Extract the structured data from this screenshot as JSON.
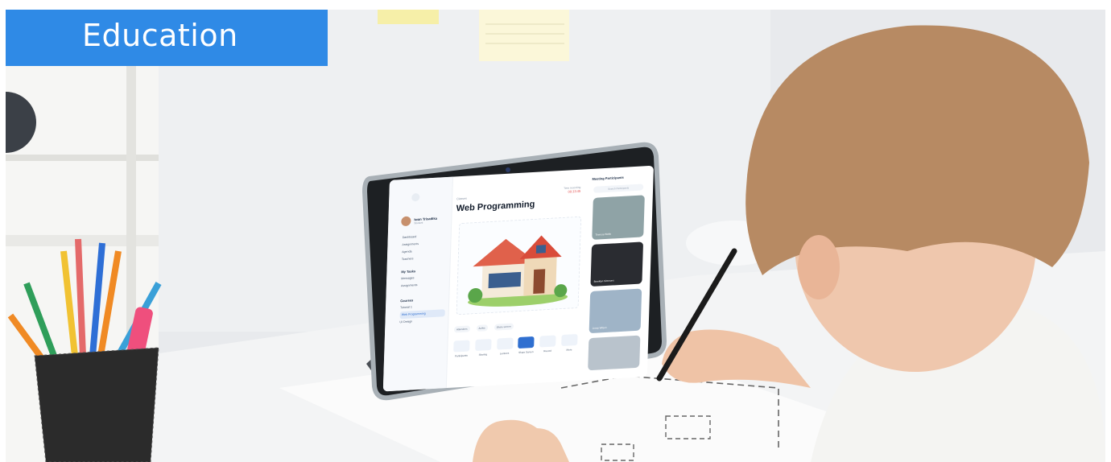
{
  "banner": {
    "label": "Education"
  },
  "tablet_ui": {
    "sidebar": {
      "profile_name": "Iwan Trisadika",
      "profile_role": "Student",
      "nav_items": [
        "Dashboard",
        "Assignments",
        "Agenda",
        "Teachers"
      ],
      "section_my_tasks": "My Tasks",
      "task_items": [
        "Messages",
        "Assignments"
      ],
      "section_courses": "Courses",
      "course_items": [
        "Tutorial 1",
        "Web Programming",
        "UI Design"
      ]
    },
    "main": {
      "breadcrumb": "Classes",
      "title": "Web Programming",
      "recording_label": "Time recording",
      "recording_time": "00:13:45",
      "attendance_pills": [
        "Attendees",
        "Active",
        "Share screen"
      ],
      "tools": [
        "Participants",
        "Sharing",
        "Lectures",
        "Share Screen",
        "Record",
        "More"
      ]
    },
    "participants": {
      "heading": "Meeting Participants",
      "search_placeholder": "Search Participants",
      "tiles": [
        "Theresa Webb",
        "Brooklyn Simmons",
        "Jenny Wilson"
      ]
    }
  }
}
